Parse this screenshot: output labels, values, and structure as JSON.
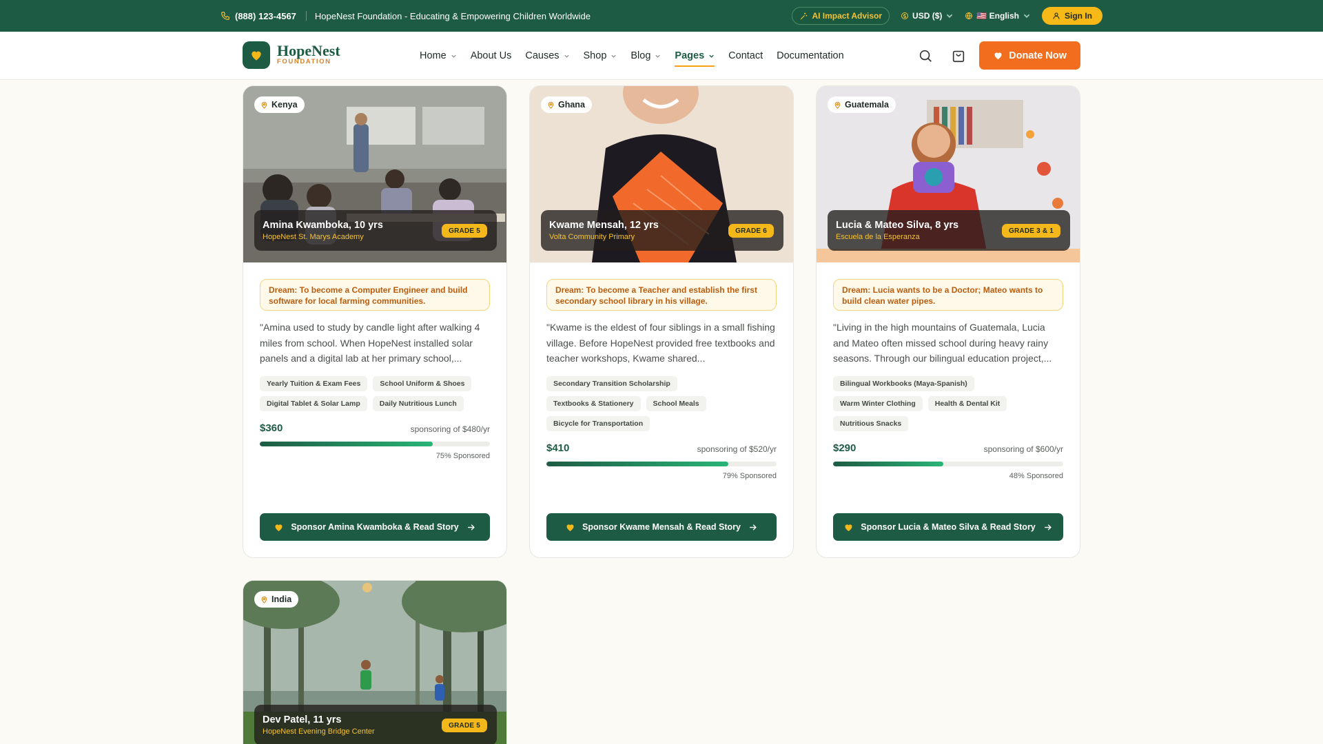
{
  "topbar": {
    "phone": "(888) 123-4567",
    "tagline": "HopeNest Foundation - Educating & Empowering Children Worldwide",
    "ai_advisor": "AI Impact Advisor",
    "currency": "USD ($)",
    "language": "🇺🇸 English",
    "sign_in": "Sign In"
  },
  "header": {
    "logo_name": "HopeNest",
    "logo_sub": "FOUNDATION",
    "nav": [
      {
        "label": "Home"
      },
      {
        "label": "About Us"
      },
      {
        "label": "Causes"
      },
      {
        "label": "Shop"
      },
      {
        "label": "Blog"
      },
      {
        "label": "Pages"
      },
      {
        "label": "Contact"
      },
      {
        "label": "Documentation"
      }
    ],
    "donate": "Donate Now"
  },
  "children": [
    {
      "location": "Kenya",
      "name": "Amina Kwamboka, 10 yrs",
      "school": "HopeNest St. Marys Academy",
      "grade": "GRADE 5",
      "dream": "Dream: To become a Computer Engineer and build software for local farming communities.",
      "quote": "\"Amina used to study by candle light after walking 4 miles from school. When HopeNest installed solar panels and a digital lab at her primary school,...",
      "tags": [
        "Yearly Tuition & Exam Fees",
        "School Uniform & Shoes",
        "Digital Tablet & Solar Lamp",
        "Daily Nutritious Lunch"
      ],
      "raised": "$360",
      "goal": "sponsoring of $480/yr",
      "progress": 0.75,
      "pct_label": "75% Sponsored",
      "cta": "Sponsor Amina Kwamboka & Read Story"
    },
    {
      "location": "Ghana",
      "name": "Kwame Mensah, 12 yrs",
      "school": "Volta Community Primary",
      "grade": "GRADE 6",
      "dream": "Dream: To become a Teacher and establish the first secondary school library in his village.",
      "quote": "\"Kwame is the eldest of four siblings in a small fishing village. Before HopeNest provided free textbooks and teacher workshops, Kwame shared...",
      "tags": [
        "Secondary Transition Scholarship",
        "Textbooks & Stationery",
        "School Meals",
        "Bicycle for Transportation"
      ],
      "raised": "$410",
      "goal": "sponsoring of $520/yr",
      "progress": 0.79,
      "pct_label": "79% Sponsored",
      "cta": "Sponsor Kwame Mensah & Read Story"
    },
    {
      "location": "Guatemala",
      "name": "Lucia & Mateo Silva, 8 yrs",
      "school": "Escuela de la Esperanza",
      "grade": "GRADE 3 & 1",
      "dream": "Dream: Lucia wants to be a Doctor; Mateo wants to build clean water pipes.",
      "quote": "\"Living in the high mountains of Guatemala, Lucia and Mateo often missed school during heavy rainy seasons. Through our bilingual education project,...",
      "tags": [
        "Bilingual Workbooks (Maya-Spanish)",
        "Warm Winter Clothing",
        "Health & Dental Kit",
        "Nutritious Snacks"
      ],
      "raised": "$290",
      "goal": "sponsoring of $600/yr",
      "progress": 0.48,
      "pct_label": "48% Sponsored",
      "cta": "Sponsor Lucia & Mateo Silva & Read Story"
    },
    {
      "location": "India",
      "name": "Dev Patel, 11 yrs",
      "school": "HopeNest Evening Bridge Center",
      "grade": "GRADE 5"
    }
  ],
  "colors": {
    "brand": "#1e5b44",
    "accent": "#f26d1d",
    "gold": "#f5b81a"
  }
}
